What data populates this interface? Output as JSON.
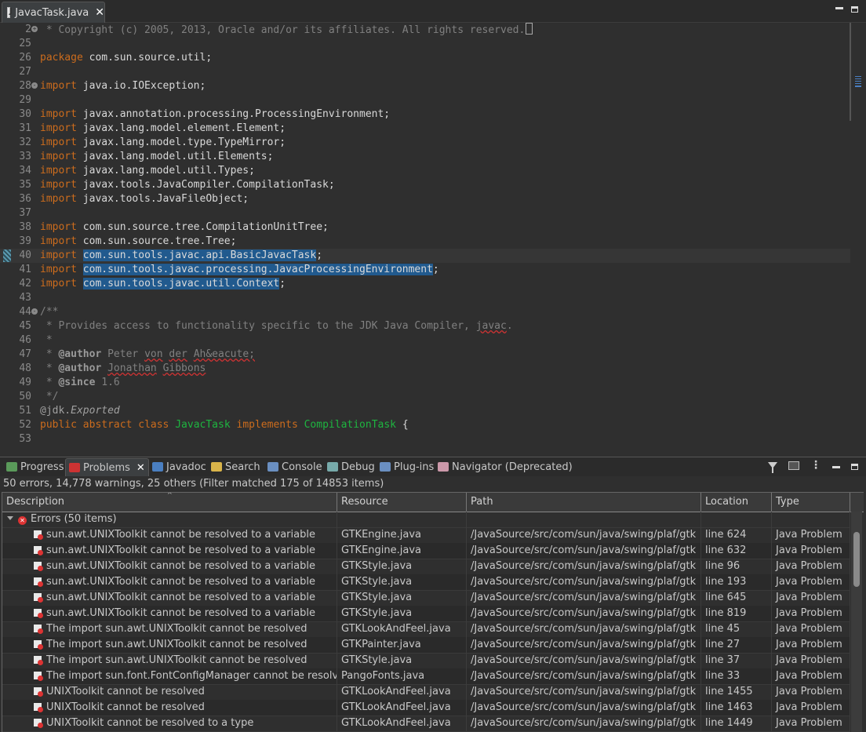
{
  "editor_tab": {
    "title": "JavacTask.java"
  },
  "editor": {
    "lines": [
      {
        "n": "2",
        "fold": "+",
        "html": "<span class=\"cm\"> * Copyright (c) 2005, 2013, Oracle and/or its affiliates. All rights reserved.</span><span class=\"boxchar\"></span>"
      },
      {
        "n": "25",
        "html": ""
      },
      {
        "n": "26",
        "html": "<span class=\"kw\">package</span> com.sun.source.util;"
      },
      {
        "n": "27",
        "html": ""
      },
      {
        "n": "28",
        "fold": "-",
        "html": "<span class=\"kw\">import</span> java.io.IOException;"
      },
      {
        "n": "29",
        "html": ""
      },
      {
        "n": "30",
        "html": "<span class=\"kw\">import</span> javax.annotation.processing.ProcessingEnvironment;"
      },
      {
        "n": "31",
        "html": "<span class=\"kw\">import</span> javax.lang.model.element.Element;"
      },
      {
        "n": "32",
        "html": "<span class=\"kw\">import</span> javax.lang.model.type.TypeMirror;"
      },
      {
        "n": "33",
        "html": "<span class=\"kw\">import</span> javax.lang.model.util.Elements;"
      },
      {
        "n": "34",
        "html": "<span class=\"kw\">import</span> javax.lang.model.util.Types;"
      },
      {
        "n": "35",
        "html": "<span class=\"kw\">import</span> javax.tools.JavaCompiler.CompilationTask;"
      },
      {
        "n": "36",
        "html": "<span class=\"kw\">import</span> javax.tools.JavaFileObject;"
      },
      {
        "n": "37",
        "html": ""
      },
      {
        "n": "38",
        "html": "<span class=\"kw\">import</span> com.sun.source.tree.CompilationUnitTree;"
      },
      {
        "n": "39",
        "html": "<span class=\"kw\">import</span> com.sun.source.tree.Tree;"
      },
      {
        "n": "40",
        "cur": true,
        "marker": true,
        "html": "<span class=\"kw\">import</span> <span class=\"sel\">com.sun.tools.javac.api.BasicJavacTask</span>;"
      },
      {
        "n": "41",
        "html": "<span class=\"kw\">import</span> <span class=\"sel\">com.sun.tools.javac.processing.JavacProcessingEnvironment</span>;"
      },
      {
        "n": "42",
        "html": "<span class=\"kw\">import</span> <span class=\"sel\">com.sun.tools.javac.util.Context</span>;"
      },
      {
        "n": "43",
        "html": ""
      },
      {
        "n": "44",
        "fold": "-",
        "html": "<span class=\"cm\">/**</span>"
      },
      {
        "n": "45",
        "html": "<span class=\"cm\"> * Provides access to functionality specific to the JDK Java Compiler, <span class=\"sq\">javac</span>.</span>"
      },
      {
        "n": "46",
        "html": "<span class=\"cm\"> *</span>"
      },
      {
        "n": "47",
        "html": "<span class=\"cm\"> * <span class=\"tag\">@author</span> Peter <span class=\"sq\">von</span> <span class=\"sq\">der</span> <span class=\"sq\">Ah&amp;eacute;</span></span>"
      },
      {
        "n": "48",
        "html": "<span class=\"cm\"> * <span class=\"tag\">@author</span> <span class=\"sq\">Jonathan</span> <span class=\"sq\">Gibbons</span></span>"
      },
      {
        "n": "49",
        "html": "<span class=\"cm\"> * <span class=\"tag\">@since</span> 1.6</span>"
      },
      {
        "n": "50",
        "html": "<span class=\"cm\"> */</span>"
      },
      {
        "n": "51",
        "html": "<span class=\"ann\">@jdk.</span><span class=\"ital\">Exported</span>"
      },
      {
        "n": "52",
        "html": "<span class=\"kw\">public</span> <span class=\"kw\">abstract</span> <span class=\"kw\">class</span> <span class=\"cls\">JavacTask</span> <span class=\"kw\">implements</span> <span class=\"cls\">CompilationTask</span> {"
      },
      {
        "n": "53",
        "html": ""
      }
    ]
  },
  "views": {
    "tabs": [
      {
        "label": "Progress",
        "icon": "progress-icon",
        "color": "#5a9a5a"
      },
      {
        "label": "Problems",
        "icon": "problems-icon",
        "color": "#c33",
        "active": true
      },
      {
        "label": "Javadoc",
        "icon": "javadoc-icon",
        "color": "#4a7fc1"
      },
      {
        "label": "Search",
        "icon": "search-icon",
        "color": "#d9b44a"
      },
      {
        "label": "Console",
        "icon": "console-icon",
        "color": "#6a8fc1"
      },
      {
        "label": "Debug",
        "icon": "debug-icon",
        "color": "#7aa"
      },
      {
        "label": "Plug-ins",
        "icon": "plugins-icon",
        "color": "#6a8fc1"
      },
      {
        "label": "Navigator (Deprecated)",
        "icon": "navigator-icon",
        "color": "#c9a"
      }
    ]
  },
  "problems": {
    "summary": "50 errors, 14,778 warnings, 25 others (Filter matched 175 of 14853 items)",
    "columns": [
      "Description",
      "Resource",
      "Path",
      "Location",
      "Type"
    ],
    "group_label": "Errors (50 items)",
    "rows": [
      [
        "sun.awt.UNIXToolkit cannot be resolved to a variable",
        "GTKEngine.java",
        "/JavaSource/src/com/sun/java/swing/plaf/gtk",
        "line 624",
        "Java Problem"
      ],
      [
        "sun.awt.UNIXToolkit cannot be resolved to a variable",
        "GTKEngine.java",
        "/JavaSource/src/com/sun/java/swing/plaf/gtk",
        "line 632",
        "Java Problem"
      ],
      [
        "sun.awt.UNIXToolkit cannot be resolved to a variable",
        "GTKStyle.java",
        "/JavaSource/src/com/sun/java/swing/plaf/gtk",
        "line 96",
        "Java Problem"
      ],
      [
        "sun.awt.UNIXToolkit cannot be resolved to a variable",
        "GTKStyle.java",
        "/JavaSource/src/com/sun/java/swing/plaf/gtk",
        "line 193",
        "Java Problem"
      ],
      [
        "sun.awt.UNIXToolkit cannot be resolved to a variable",
        "GTKStyle.java",
        "/JavaSource/src/com/sun/java/swing/plaf/gtk",
        "line 645",
        "Java Problem"
      ],
      [
        "sun.awt.UNIXToolkit cannot be resolved to a variable",
        "GTKStyle.java",
        "/JavaSource/src/com/sun/java/swing/plaf/gtk",
        "line 819",
        "Java Problem"
      ],
      [
        "The import sun.awt.UNIXToolkit cannot be resolved",
        "GTKLookAndFeel.java",
        "/JavaSource/src/com/sun/java/swing/plaf/gtk",
        "line 45",
        "Java Problem"
      ],
      [
        "The import sun.awt.UNIXToolkit cannot be resolved",
        "GTKPainter.java",
        "/JavaSource/src/com/sun/java/swing/plaf/gtk",
        "line 27",
        "Java Problem"
      ],
      [
        "The import sun.awt.UNIXToolkit cannot be resolved",
        "GTKStyle.java",
        "/JavaSource/src/com/sun/java/swing/plaf/gtk",
        "line 37",
        "Java Problem"
      ],
      [
        "The import sun.font.FontConfigManager cannot be resolved",
        "PangoFonts.java",
        "/JavaSource/src/com/sun/java/swing/plaf/gtk",
        "line 33",
        "Java Problem"
      ],
      [
        "UNIXToolkit cannot be resolved",
        "GTKLookAndFeel.java",
        "/JavaSource/src/com/sun/java/swing/plaf/gtk",
        "line 1455",
        "Java Problem"
      ],
      [
        "UNIXToolkit cannot be resolved",
        "GTKLookAndFeel.java",
        "/JavaSource/src/com/sun/java/swing/plaf/gtk",
        "line 1463",
        "Java Problem"
      ],
      [
        "UNIXToolkit cannot be resolved to a type",
        "GTKLookAndFeel.java",
        "/JavaSource/src/com/sun/java/swing/plaf/gtk",
        "line 1449",
        "Java Problem"
      ]
    ]
  }
}
